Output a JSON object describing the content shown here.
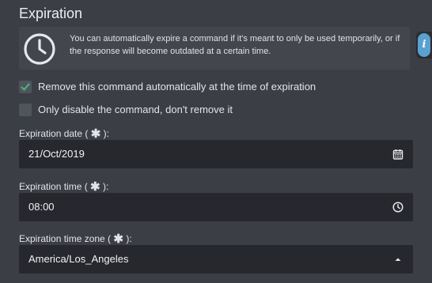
{
  "section": {
    "title": "Expiration"
  },
  "info_box": {
    "icon": "clock-icon",
    "text": "You can automatically expire a command if it's meant to only be used temporarily, or if the response will become outdated at a certain time."
  },
  "side_tab": {
    "icon": "info-icon",
    "label": "i"
  },
  "checkboxes": [
    {
      "label": "Remove this command automatically at the time of expiration",
      "checked": true
    },
    {
      "label": "Only disable the command, don't remove it",
      "checked": false
    }
  ],
  "fields": {
    "date": {
      "label": "Expiration date (",
      "required_mark": "✱",
      "label_end": "):",
      "value": "21/Oct/2019",
      "icon": "calendar-icon"
    },
    "time": {
      "label": "Expiration time (",
      "required_mark": "✱",
      "label_end": "):",
      "value": "08:00",
      "icon": "clock-icon"
    },
    "timezone": {
      "label": "Expiration time zone (",
      "required_mark": "✱",
      "label_end": "):",
      "value": "America/Los_Angeles",
      "icon": "caret-up-icon"
    }
  },
  "colors": {
    "background": "#3b3e45",
    "input_background": "#26282d",
    "checkbox_check": "#46b37a",
    "info_tab": "#5aa0d0"
  }
}
